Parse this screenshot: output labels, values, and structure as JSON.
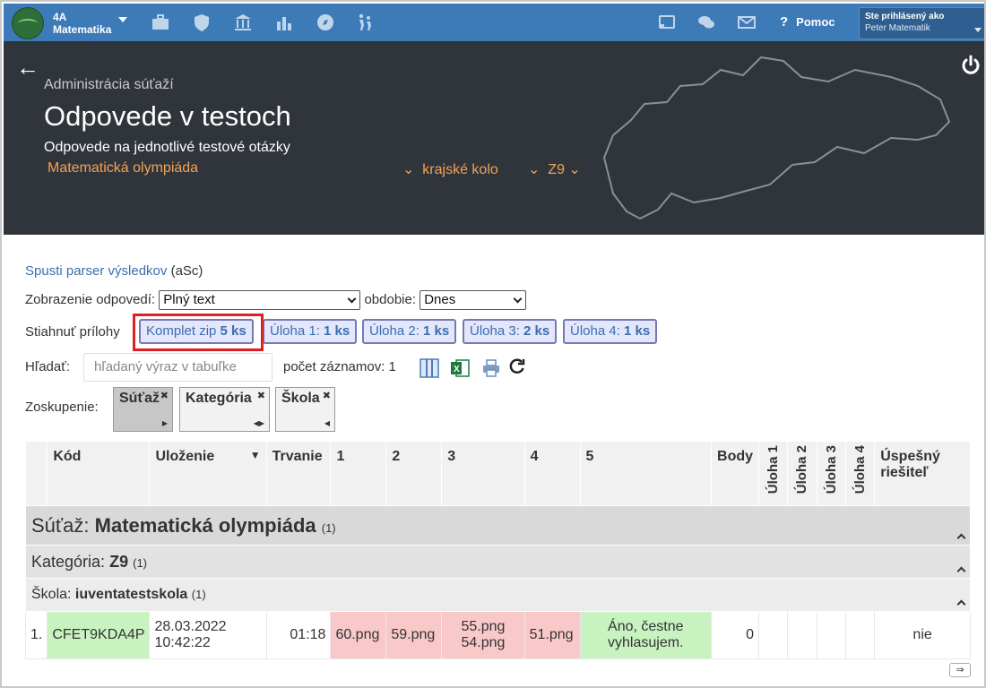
{
  "topbar": {
    "class_name": "4A",
    "class_subject": "Matematika",
    "help_label": "Pomoc",
    "user_label": "Ste prihlásený ako",
    "user_name": "Peter Matematik"
  },
  "header": {
    "breadcrumb": "Administrácia súťaží",
    "title": "Odpovede v testoch",
    "subtitle": "Odpovede na jednotlivé testové otázky",
    "competition": "Matematická olympiáda",
    "round": "krajské kolo",
    "category": "Z9"
  },
  "toolbar": {
    "parser_link": "Spusti parser výsledkov",
    "parser_suffix": "(aSc)",
    "display_label": "Zobrazenie odpovedí:",
    "display_value": "Plný text",
    "period_label": "obdobie:",
    "period_value": "Dnes",
    "attachments_label": "Stiahnuť prílohy",
    "downloads": [
      {
        "label": "Komplet zip",
        "count": "5 ks"
      },
      {
        "label": "Úloha 1:",
        "count": "1 ks"
      },
      {
        "label": "Úloha 2:",
        "count": "1 ks"
      },
      {
        "label": "Úloha 3:",
        "count": "2 ks"
      },
      {
        "label": "Úloha 4:",
        "count": "1 ks"
      }
    ],
    "search_label": "Hľadať:",
    "search_placeholder": "hľadaný výraz v tabuľke",
    "record_count": "počet záznamov: 1",
    "grouping_label": "Zoskupenie:",
    "groups": [
      "Súťaž",
      "Kategória",
      "Škola"
    ]
  },
  "table": {
    "headers": [
      "Kód",
      "Uloženie",
      "Trvanie",
      "1",
      "2",
      "3",
      "4",
      "5",
      "Body",
      "Úloha 1",
      "Úloha 2",
      "Úloha 3",
      "Úloha 4",
      "Úspešný riešiteľ"
    ],
    "group1_label": "Súťaž:",
    "group1_value": "Matematická olympiáda",
    "group1_count": "(1)",
    "group2_label": "Kategória:",
    "group2_value": "Z9",
    "group2_count": "(1)",
    "group3_label": "Škola:",
    "group3_value": "iuventatestskola",
    "group3_count": "(1)",
    "row": {
      "num": "1.",
      "code": "CFET9KDA4P",
      "date": "28.03.2022",
      "time": "10:42:22",
      "duration": "01:18",
      "q1": "60.png",
      "q2": "59.png",
      "q3a": "55.png",
      "q3b": "54.png",
      "q4": "51.png",
      "q5a": "Áno, čestne",
      "q5b": "vyhlasujem.",
      "points": "0",
      "successful": "nie"
    }
  },
  "colors": {
    "topbar": "#3d7ab8",
    "header_bg": "#30343b",
    "accent_orange": "#f2a355",
    "highlight_red": "#e02020",
    "pink_cell": "#f9c9c9",
    "green_cell": "#c8f3c0"
  }
}
